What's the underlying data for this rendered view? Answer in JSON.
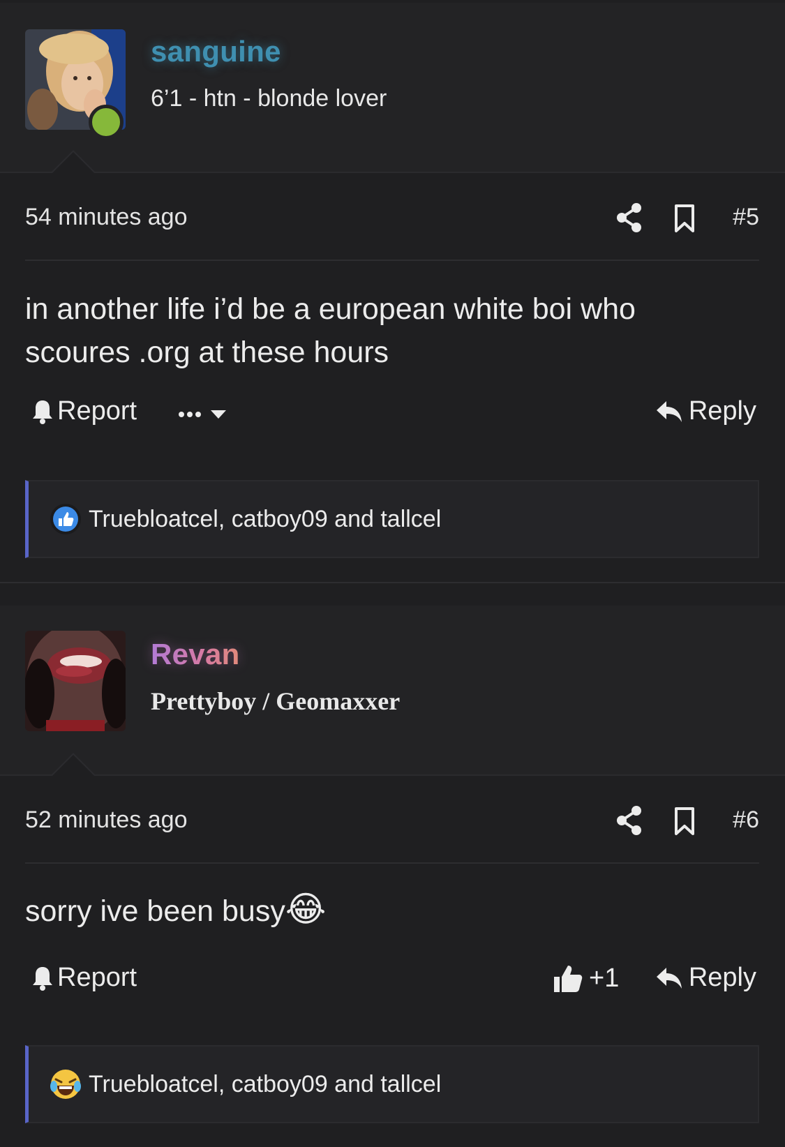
{
  "posts": [
    {
      "username": "sanguine",
      "user_title": "6’1 - htn - blonde lover",
      "time": "54 minutes ago",
      "post_number": "#5",
      "message_lines": [
        "in another life i’d be a european white boi who",
        "scoures .org at these hours"
      ],
      "report_label": "Report",
      "reply_label": "Reply",
      "reaction_users": "Truebloatcel, catboy09 and tallcel",
      "reaction_icon": "like-reaction-icon",
      "online": true
    },
    {
      "username": "Revan",
      "user_title": "Prettyboy / Geomaxxer",
      "time": "52 minutes ago",
      "post_number": "#6",
      "message": "sorry ive been busy",
      "message_emoji": "😂",
      "report_label": "Report",
      "like_count": "+1",
      "reply_label": "Reply",
      "reaction_users": "Truebloatcel, catboy09 and tallcel",
      "reaction_icon": "laugh-reaction-icon"
    }
  ],
  "colors": {
    "background": "#1f1f21",
    "username_1": "#3f8fb0",
    "online": "#86b83a",
    "reaction_border": "#5965c8"
  }
}
